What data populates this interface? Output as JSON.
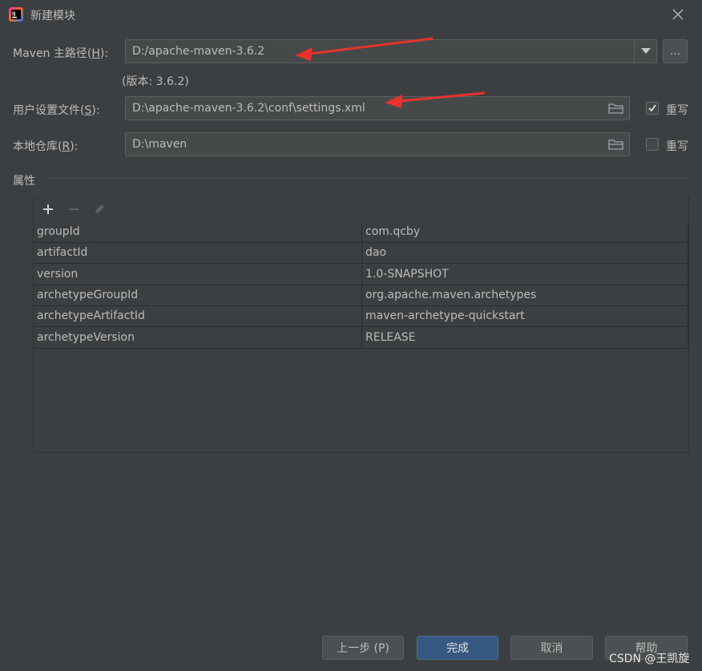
{
  "window": {
    "title": "新建模块"
  },
  "maven_home": {
    "label_prefix": "Maven 主路径(",
    "label_key": "H",
    "label_suffix": "):",
    "value": "D:/apache-maven-3.6.2",
    "version": "(版本: 3.6.2)",
    "browse_label": "..."
  },
  "user_settings": {
    "label_prefix": "用户设置文件(",
    "label_key": "S",
    "label_suffix": "):",
    "value": "D:\\apache-maven-3.6.2\\conf\\settings.xml",
    "override_label": "重写",
    "override_checked": true
  },
  "local_repo": {
    "label_prefix": "本地仓库(",
    "label_key": "R",
    "label_suffix": "):",
    "value": "D:\\maven",
    "override_label": "重写",
    "override_checked": false
  },
  "properties": {
    "section_title": "属性",
    "rows": [
      {
        "key": "groupId",
        "value": "com.qcby"
      },
      {
        "key": "artifactId",
        "value": "dao"
      },
      {
        "key": "version",
        "value": "1.0-SNAPSHOT"
      },
      {
        "key": "archetypeGroupId",
        "value": "org.apache.maven.archetypes"
      },
      {
        "key": "archetypeArtifactId",
        "value": "maven-archetype-quickstart"
      },
      {
        "key": "archetypeVersion",
        "value": "RELEASE"
      }
    ]
  },
  "buttons": {
    "previous": "上一步 (P)",
    "finish": "完成",
    "cancel": "取消",
    "help": "帮助"
  },
  "watermark": "CSDN @王凯旋",
  "colors": {
    "background": "#3c3f41",
    "field": "#45494a",
    "primary": "#365880",
    "arrow": "#e8322d"
  }
}
